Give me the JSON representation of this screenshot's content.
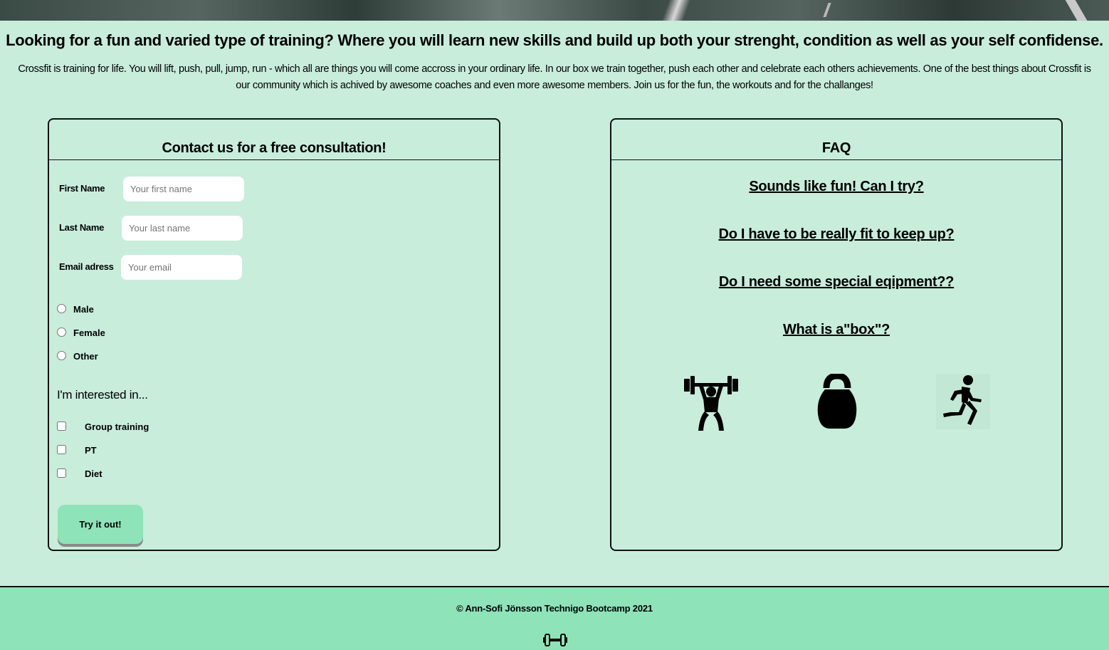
{
  "intro": {
    "title": "Looking for a fun and varied type of training? Where you will learn new skills and build up both your strenght, condition as well as your self confidense.",
    "text": "Crossfit is training for life. You will lift, push, pull, jump, run - which all are things you will come accross in your ordinary life. In our box we train together, push each other and celebrate each others achievements. One of the best things about Crossfit is our community which is achived by awesome coaches and even more awesome members. Join us for the fun, the workouts and for the challanges!"
  },
  "contact": {
    "title": "Contact us for a free consultation!",
    "fields": [
      {
        "label": "First Name",
        "placeholder": "Your first name"
      },
      {
        "label": "Last Name",
        "placeholder": "Your last name"
      },
      {
        "label": "Email adress",
        "placeholder": "Your email"
      }
    ],
    "genders": [
      "Male",
      "Female",
      "Other"
    ],
    "interest_title": "I'm interested in...",
    "interests": [
      "Group training",
      "PT",
      "Diet"
    ],
    "submit_label": "Try it out!"
  },
  "faq": {
    "title": "FAQ",
    "questions": [
      "Sounds like fun! Can I try?",
      "Do I have to be really fit to keep up?",
      "Do I need some special eqipment??",
      "What is a\"box\"?"
    ],
    "icons": [
      "weightlifter-icon",
      "kettlebell-icon",
      "runner-icon"
    ]
  },
  "footer": {
    "text": "© Ann-Sofi Jönsson Technigo Bootcamp 2021",
    "icon": "dumbbell-icon"
  },
  "colors": {
    "background": "#c8eddb",
    "footer_bg": "#8ee3b9",
    "button_bg": "#8ee3b9"
  }
}
